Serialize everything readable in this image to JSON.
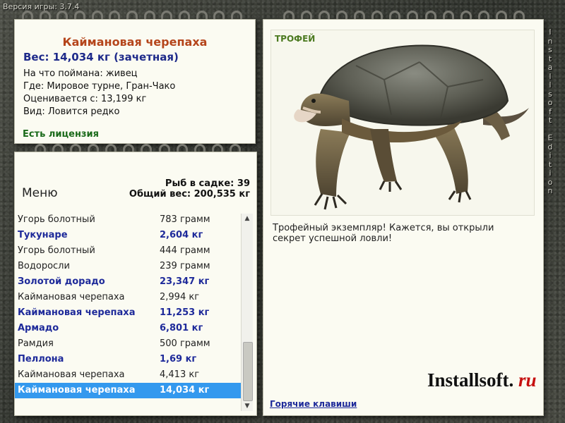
{
  "version": "Версия игры: 3.7.4",
  "fish": {
    "title": "Каймановая черепаха",
    "weight_line": "Вес: 14,034 кг (зачетная)",
    "bait": "На что поймана: живец",
    "location": "Где: Мировое турне, Гран-Чако",
    "valued_from": "Оценивается с: 13,199 кг",
    "species": "Вид: Ловится редко",
    "license": "Есть лицензия"
  },
  "list_panel": {
    "menu_label": "Меню",
    "fish_count": "Рыб в садке: 39",
    "total_weight": "Общий вес: 200,535 кг",
    "rows": [
      {
        "name": "Угорь болотный",
        "weight": "783 грамм",
        "trophy": false
      },
      {
        "name": "Тукунаре",
        "weight": "2,604 кг",
        "trophy": true
      },
      {
        "name": "Угорь болотный",
        "weight": "444 грамм",
        "trophy": false
      },
      {
        "name": "Водоросли",
        "weight": "239 грамм",
        "trophy": false
      },
      {
        "name": "Золотой дорадо",
        "weight": "23,347 кг",
        "trophy": true
      },
      {
        "name": "Каймановая черепаха",
        "weight": "2,994 кг",
        "trophy": false
      },
      {
        "name": "Каймановая черепаха",
        "weight": "11,253 кг",
        "trophy": true
      },
      {
        "name": "Армадо",
        "weight": "6,801 кг",
        "trophy": true
      },
      {
        "name": "Рамдия",
        "weight": "500 грамм",
        "trophy": false
      },
      {
        "name": "Пеллона",
        "weight": "1,69 кг",
        "trophy": true
      },
      {
        "name": "Каймановая черепаха",
        "weight": "4,413 кг",
        "trophy": false
      },
      {
        "name": "Каймановая черепаха",
        "weight": "14,034 кг",
        "trophy": true,
        "selected": true
      }
    ]
  },
  "trophy_panel": {
    "badge": "ТРОФЕЙ",
    "description": "Трофейный экземпляр! Кажется, вы открыли секрет успешной ловли!",
    "brand_main": "Installsoft.",
    "brand_ru": "ru",
    "hotkeys_link": "Горячие клавиши"
  },
  "side_text": "Installsoft Edition",
  "colors": {
    "title_orange": "#b5451b",
    "trophy_blue": "#1e2a9a",
    "license_green": "#1a6a1a",
    "selection_blue": "#3399ee"
  }
}
